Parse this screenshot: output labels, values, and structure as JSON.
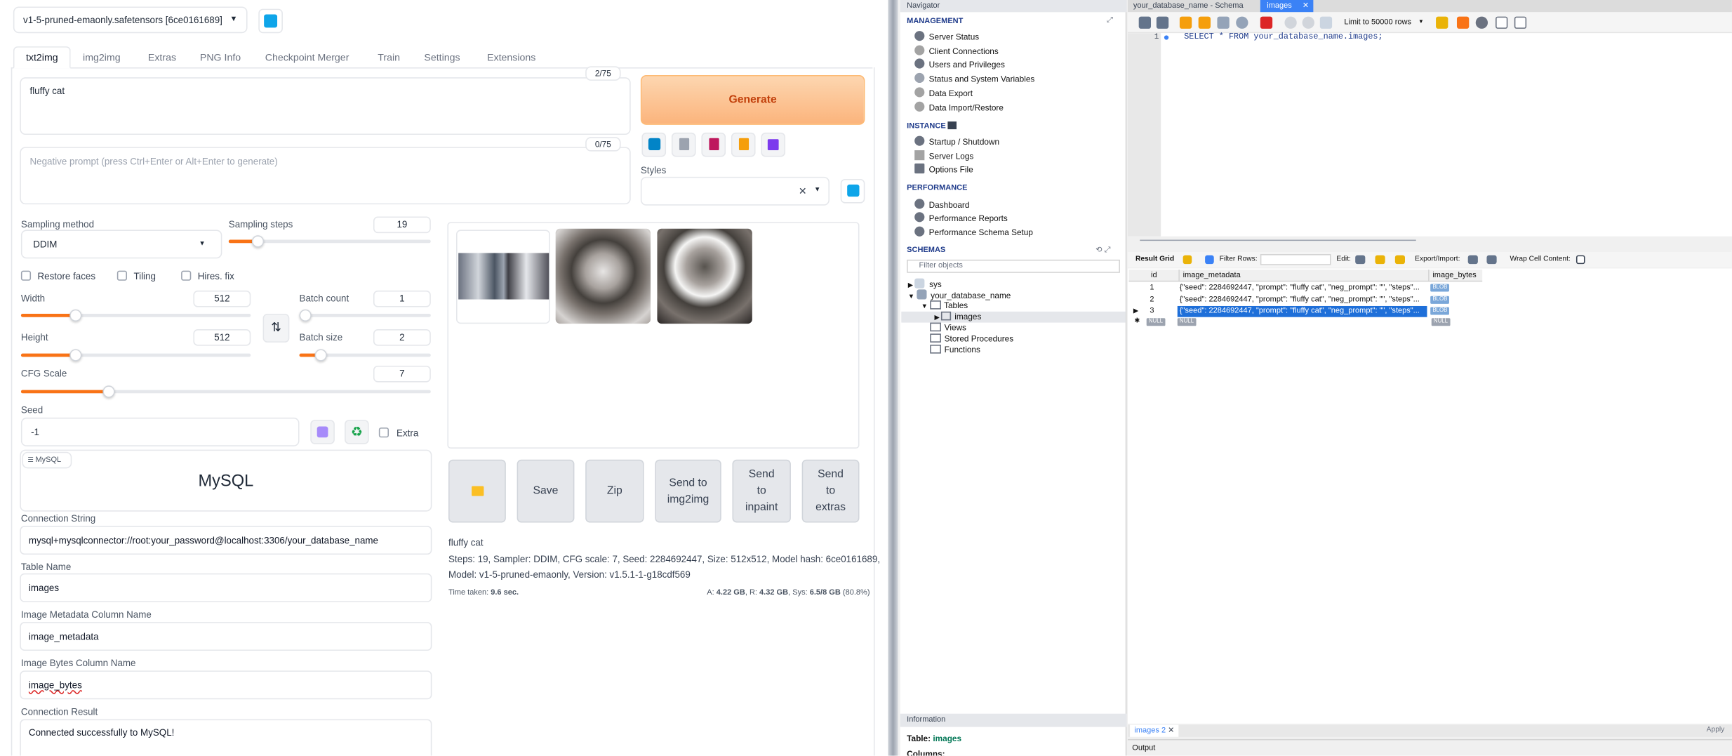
{
  "sd": {
    "checkpoint": "v1-5-pruned-emaonly.safetensors [6ce0161689]",
    "tabs": [
      "txt2img",
      "img2img",
      "Extras",
      "PNG Info",
      "Checkpoint Merger",
      "Train",
      "Settings",
      "Extensions"
    ],
    "prompt": "fluffy cat",
    "prompt_counter": "2/75",
    "neg_placeholder": "Negative prompt (press Ctrl+Enter or Alt+Enter to generate)",
    "neg_counter": "0/75",
    "generate_label": "Generate",
    "styles_label": "Styles",
    "sampling_method_label": "Sampling method",
    "sampling_method": "DDIM",
    "sampling_steps_label": "Sampling steps",
    "sampling_steps": "19",
    "restore_faces": "Restore faces",
    "tiling": "Tiling",
    "hires_fix": "Hires. fix",
    "width_label": "Width",
    "width": "512",
    "height_label": "Height",
    "height": "512",
    "batch_count_label": "Batch count",
    "batch_count": "1",
    "batch_size_label": "Batch size",
    "batch_size": "2",
    "cfg_label": "CFG Scale",
    "cfg": "7",
    "seed_label": "Seed",
    "seed": "-1",
    "extra_label": "Extra",
    "mysql_tab": "MySQL",
    "mysql_title": "MySQL",
    "conn_string_label": "Connection String",
    "conn_string": "mysql+mysqlconnector://root:your_password@localhost:3306/your_database_name",
    "table_name_label": "Table Name",
    "table_name": "images",
    "meta_col_label": "Image Metadata Column Name",
    "meta_col": "image_metadata",
    "bytes_col_label": "Image Bytes Column Name",
    "bytes_col": "image_bytes",
    "conn_result_label": "Connection Result",
    "conn_result": "Connected successfully to MySQL!",
    "buttons": {
      "save": "Save",
      "zip": "Zip",
      "img2img_l1": "Send to",
      "img2img_l2": "img2img",
      "inpaint_l1": "Send",
      "inpaint_l2": "to",
      "inpaint_l3": "inpaint",
      "extras_l1": "Send",
      "extras_l2": "to",
      "extras_l3": "extras"
    },
    "info_prompt": "fluffy cat",
    "info_line1": "Steps: 19, Sampler: DDIM, CFG scale: 7, Seed: 2284692447, Size: 512x512, Model hash: 6ce0161689,",
    "info_line2": "Model: v1-5-pruned-emaonly, Version: v1.5.1-1-g18cdf569",
    "time_label": "Time taken:",
    "time_value": "9.6 sec.",
    "mem_a_label": "A:",
    "mem_a": "4.22 GB",
    "mem_r_label": "R:",
    "mem_r": "4.32 GB",
    "mem_sys_label": "Sys:",
    "mem_sys": "6.5/8 GB",
    "mem_pct": "(80.8%)"
  },
  "wb": {
    "navigator_title": "Navigator",
    "management_label": "MANAGEMENT",
    "management": [
      "Server Status",
      "Client Connections",
      "Users and Privileges",
      "Status and System Variables",
      "Data Export",
      "Data Import/Restore"
    ],
    "instance_label": "INSTANCE",
    "instance": [
      "Startup / Shutdown",
      "Server Logs",
      "Options File"
    ],
    "performance_label": "PERFORMANCE",
    "performance": [
      "Dashboard",
      "Performance Reports",
      "Performance Schema Setup"
    ],
    "schemas_label": "SCHEMAS",
    "filter_placeholder": "Filter objects",
    "tree": {
      "sys": "sys",
      "db": "your_database_name",
      "tables": "Tables",
      "images": "images",
      "views": "Views",
      "procs": "Stored Procedures",
      "funcs": "Functions"
    },
    "info_label": "Information",
    "info_table_prefix": "Table:",
    "info_table": "images",
    "info_columns": "Columns:",
    "tab1": "your_database_name - Schema",
    "tab2": "images",
    "limit": "Limit to 50000 rows",
    "line_no": "1",
    "query": "SELECT * FROM your_database_name.images;",
    "result_grid": "Result Grid",
    "filter_rows": "Filter Rows:",
    "edit": "Edit:",
    "export": "Export/Import:",
    "wrap": "Wrap Cell Content:",
    "columns": [
      "id",
      "image_metadata",
      "image_bytes"
    ],
    "rows": [
      {
        "id": "1",
        "meta": "{\"seed\": 2284692447, \"prompt\": \"fluffy cat\", \"neg_prompt\": \"\", \"steps\"...",
        "bytes": "BLOB"
      },
      {
        "id": "2",
        "meta": "{\"seed\": 2284692447, \"prompt\": \"fluffy cat\", \"neg_prompt\": \"\", \"steps\"...",
        "bytes": "BLOB"
      },
      {
        "id": "3",
        "meta": "{\"seed\": 2284692447, \"prompt\": \"fluffy cat\", \"neg_prompt\": \"\", \"steps\"...",
        "bytes": "BLOB"
      }
    ],
    "null": "NULL",
    "bottom_tab": "images 2",
    "apply": "Apply",
    "output_label": "Output"
  }
}
